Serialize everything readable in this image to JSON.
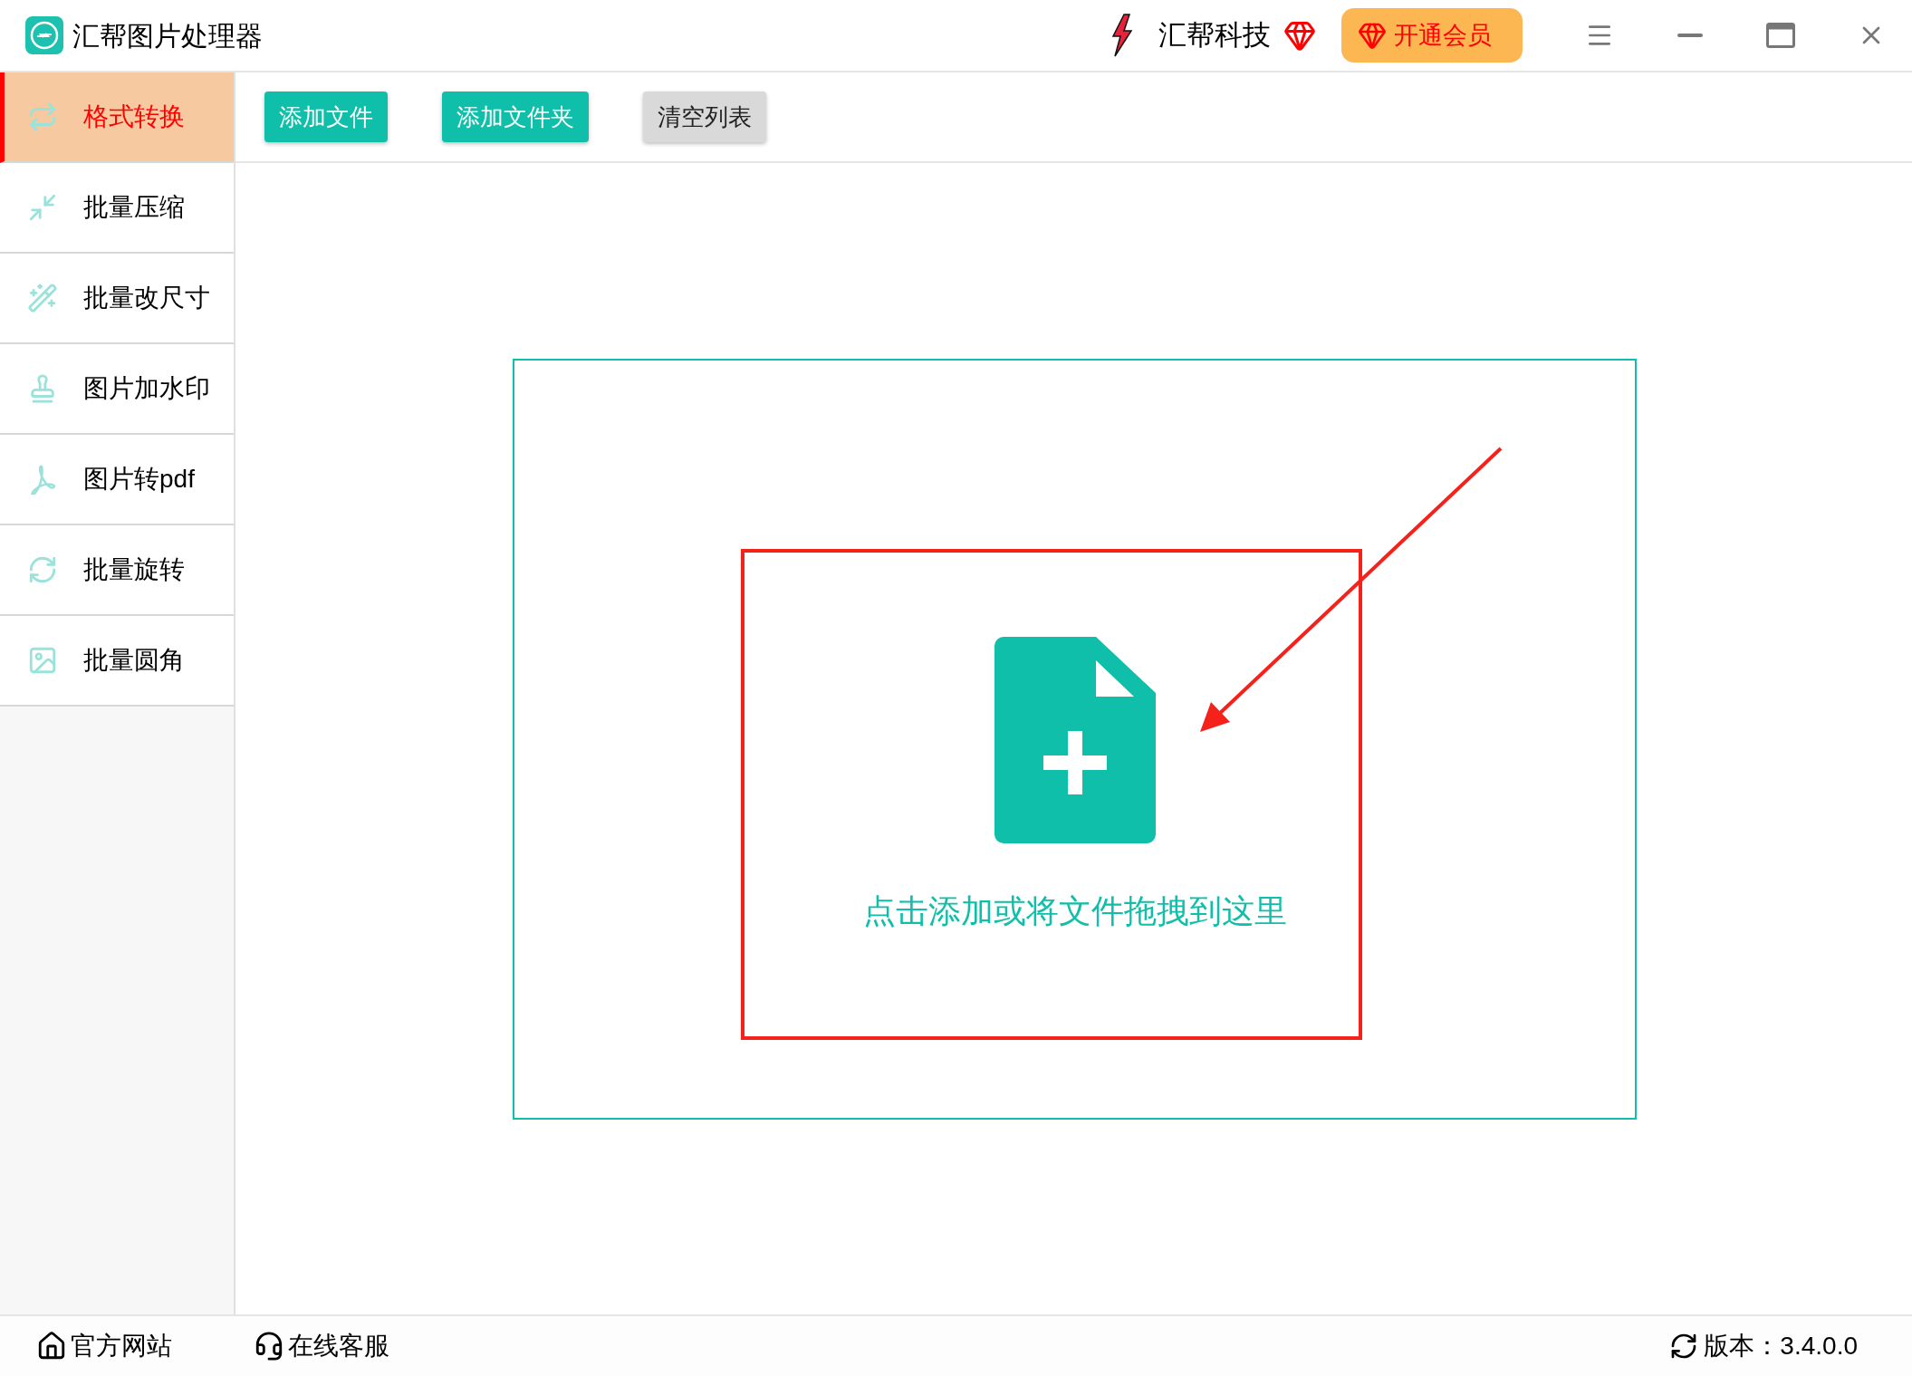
{
  "window": {
    "title": "汇帮图片处理器"
  },
  "header": {
    "brand": "汇帮科技",
    "vip_button": "开通会员"
  },
  "sidebar": {
    "items": [
      {
        "label": "格式转换",
        "kind": "convert",
        "selected": true
      },
      {
        "label": "批量压缩",
        "kind": "compress",
        "selected": false
      },
      {
        "label": "批量改尺寸",
        "kind": "resize",
        "selected": false
      },
      {
        "label": "图片加水印",
        "kind": "watermark",
        "selected": false
      },
      {
        "label": "图片转pdf",
        "kind": "pdf",
        "selected": false
      },
      {
        "label": "批量旋转",
        "kind": "rotate",
        "selected": false
      },
      {
        "label": "批量圆角",
        "kind": "image",
        "selected": false
      }
    ]
  },
  "toolbar": {
    "buttons": [
      {
        "label": "添加文件",
        "kind": "primary"
      },
      {
        "label": "添加文件夹",
        "kind": "primary"
      },
      {
        "label": "清空列表",
        "kind": "secondary"
      }
    ]
  },
  "drop_zone": {
    "hint": "点击添加或将文件拖拽到这里"
  },
  "footer": {
    "links": [
      {
        "label": "官方网站",
        "kind": "home"
      },
      {
        "label": "在线客服",
        "kind": "support"
      }
    ],
    "version": "版本：3.4.0.0"
  }
}
